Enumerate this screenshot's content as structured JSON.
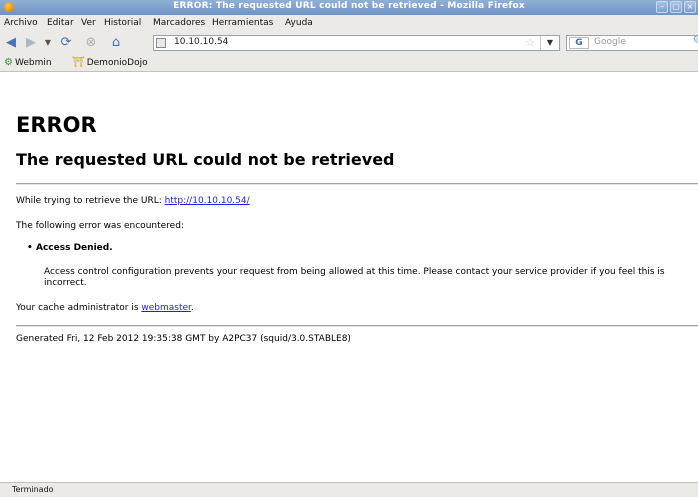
{
  "window": {
    "title": "ERROR: The requested URL could not be retrieved - Mozilla Firefox"
  },
  "menu": [
    "Archivo",
    "Editar",
    "Ver",
    "Historial",
    "Marcadores",
    "Herramientas",
    "Ayuda"
  ],
  "nav": {
    "url": "10.10.10.54",
    "search_placeholder": "Google",
    "search_engine_letter": "G"
  },
  "bookmarks": [
    "Webmin",
    "DemonioDojo"
  ],
  "page": {
    "h1": "ERROR",
    "h2": "The requested URL could not be retrieved",
    "trying_prefix": "While trying to retrieve the URL: ",
    "trying_link": "http://10.10.10.54/",
    "error_intro": "The following error was encountered:",
    "error_item": "Access Denied.",
    "error_detail": "Access control configuration prevents your request from being allowed at this time. Please contact your service provider if you feel this is incorrect.",
    "admin_prefix": "Your cache administrator is ",
    "admin_link": "webmaster",
    "admin_suffix": ".",
    "generated": "Generated Fri, 12 Feb 2012 19:35:38 GMT by A2PC37 (squid/3.0.STABLE8)"
  },
  "status": {
    "text": "Terminado"
  }
}
